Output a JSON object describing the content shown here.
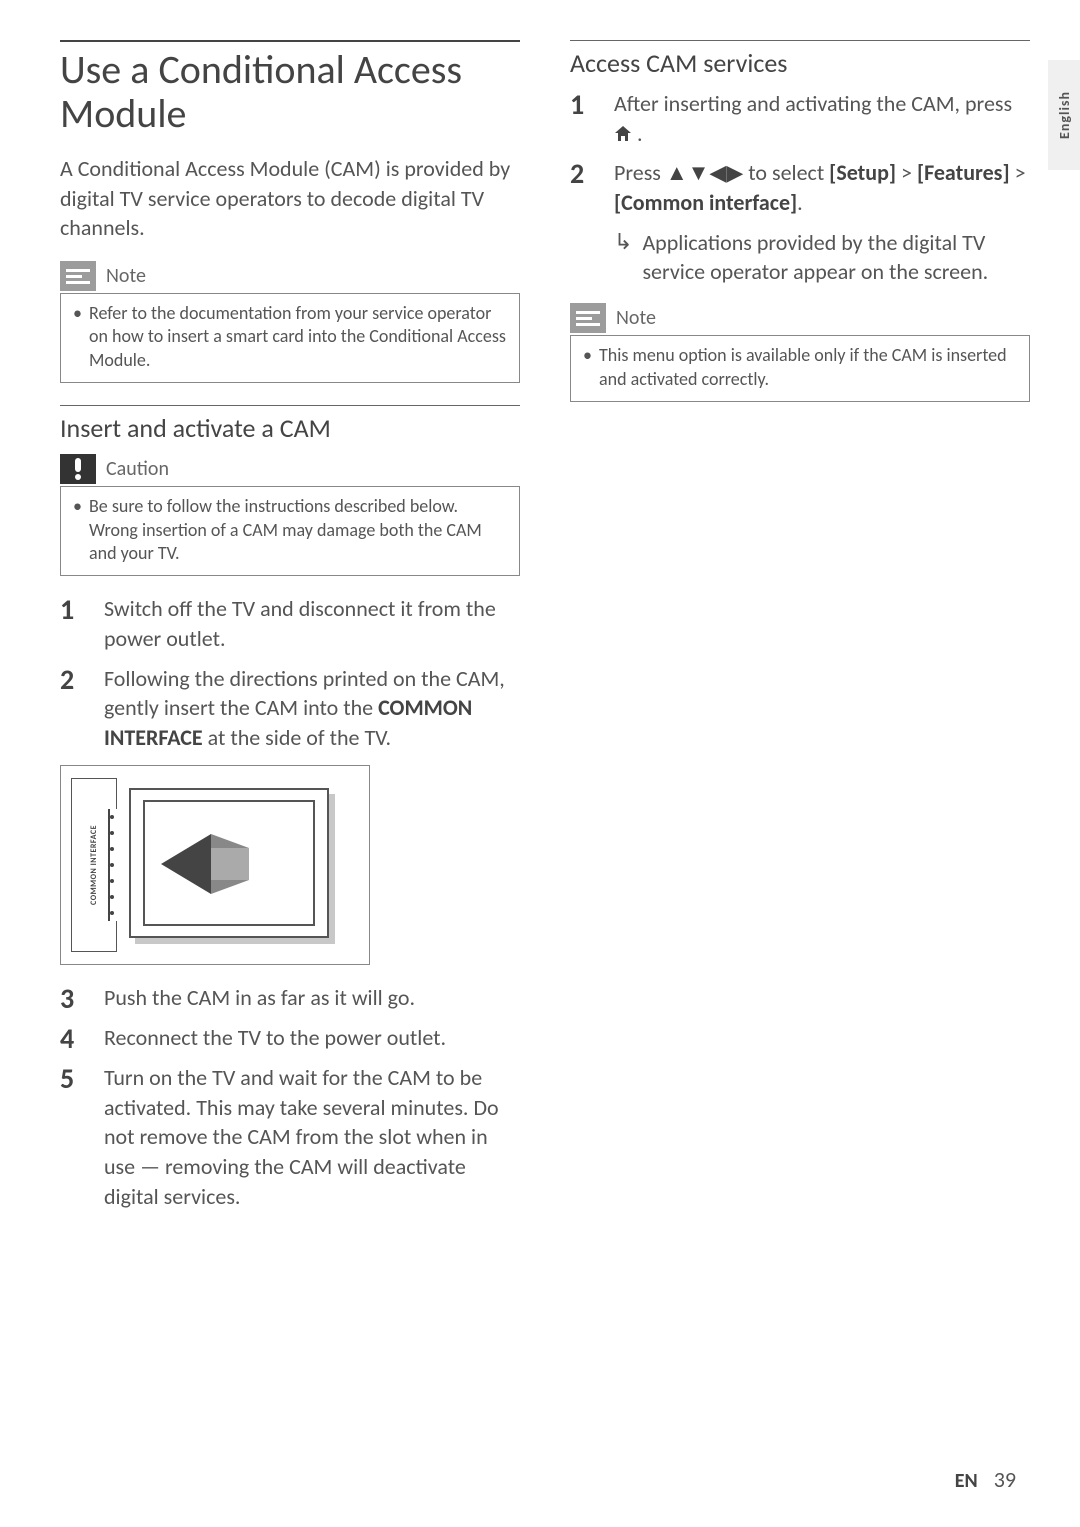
{
  "tab_label": "English",
  "left": {
    "title": "Use a Conditional Access Module",
    "intro": "A Conditional Access Module (CAM) is provided by digital TV service operators to decode digital TV channels.",
    "note_label": "Note",
    "note_text": "Refer to the documentation from your service operator on how to insert a smart card into the Conditional Access Module.",
    "sub1_title": "Insert and activate a CAM",
    "caution_label": "Caution",
    "caution_text": "Be sure to follow the instructions described below. Wrong insertion of a CAM may damage both the CAM and your TV.",
    "steps": {
      "s1": "Switch off the TV and disconnect it from the power outlet.",
      "s2_a": "Following the directions printed on the CAM, gently insert the CAM into the ",
      "s2_b": "COMMON INTERFACE",
      "s2_c": " at the side of the TV.",
      "s3": "Push the CAM in as far as it will go.",
      "s4": "Reconnect the TV to the power outlet.",
      "s5": "Turn on the TV and wait for the CAM to be activated. This may take several minutes. Do not remove the CAM from the slot when in use — removing the CAM will deactivate digital services."
    },
    "figure_slot_label": "COMMON INTERFACE"
  },
  "right": {
    "title": "Access CAM services",
    "steps": {
      "s1_a": "After inserting and activating the CAM, press ",
      "s1_b": ".",
      "s2_a": "Press ",
      "s2_b": " to select ",
      "s2_setup": "[Setup]",
      "s2_gt1": " > ",
      "s2_features": "[Features]",
      "s2_gt2": " > ",
      "s2_ci": "[Common interface]",
      "s2_c": "."
    },
    "result": "Applications provided by the digital TV service operator appear on the screen.",
    "note_label": "Note",
    "note_text": "This menu option is available only if the CAM is inserted and activated correctly."
  },
  "footer": {
    "lang": "EN",
    "page": "39"
  }
}
